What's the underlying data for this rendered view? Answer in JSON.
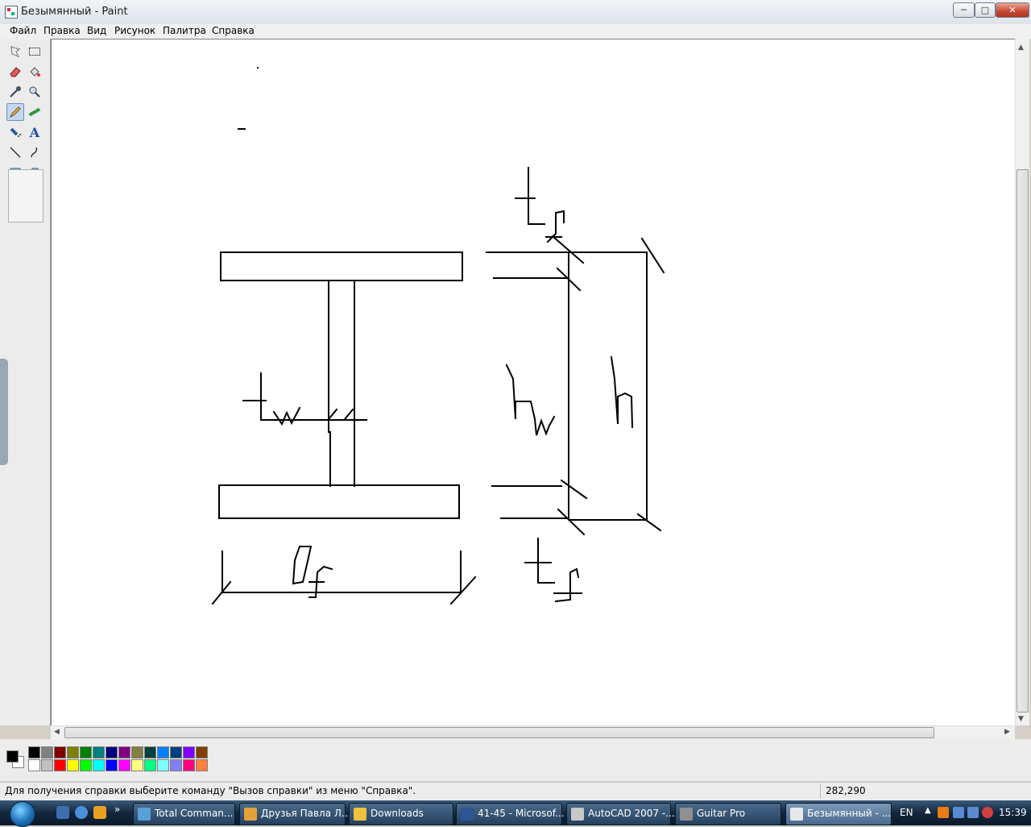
{
  "window": {
    "title": "Безымянный - Paint"
  },
  "menu": [
    "Файл",
    "Правка",
    "Вид",
    "Рисунок",
    "Палитра",
    "Справка"
  ],
  "tools": [
    "free-select",
    "rect-select",
    "eraser",
    "fill",
    "color-picker",
    "magnifier",
    "pencil",
    "brush",
    "airbrush",
    "text",
    "line",
    "curve",
    "rectangle",
    "polygon",
    "ellipse",
    "rounded-rectangle"
  ],
  "active_tool": "pencil",
  "palette": {
    "foreground": "#000000",
    "background": "#ffffff",
    "row1": [
      "#000000",
      "#808080",
      "#800000",
      "#808000",
      "#008000",
      "#008080",
      "#000080",
      "#800080",
      "#808040",
      "#004040",
      "#0080ff",
      "#004080",
      "#8000ff",
      "#804000"
    ],
    "row2": [
      "#ffffff",
      "#c0c0c0",
      "#ff0000",
      "#ffff00",
      "#00ff00",
      "#00ffff",
      "#0000ff",
      "#ff00ff",
      "#ffff80",
      "#00ff80",
      "#80ffff",
      "#8080ff",
      "#ff0080",
      "#ff8040"
    ]
  },
  "status": {
    "help_text": "Для получения справки выберите команду \"Вызов справки\" из меню \"Справка\".",
    "coords": "282,290"
  },
  "taskbar": {
    "tasks": [
      {
        "label": "Total Comman...",
        "color": "#58a0d8",
        "active": false
      },
      {
        "label": "Друзья Павла Л...",
        "color": "#e2a23a",
        "active": false
      },
      {
        "label": "Downloads",
        "color": "#f0c040",
        "active": false
      },
      {
        "label": "41-45 - Microsof...",
        "color": "#2b5797",
        "active": false
      },
      {
        "label": "AutoCAD 2007 -...",
        "color": "#c8c8c8",
        "active": false
      },
      {
        "label": "Guitar Pro",
        "color": "#909090",
        "active": false
      },
      {
        "label": "Безымянный - ...",
        "color": "#e8e8e8",
        "active": true
      }
    ],
    "lang": "EN",
    "clock": "15:39"
  },
  "scroll_chevron": "»"
}
